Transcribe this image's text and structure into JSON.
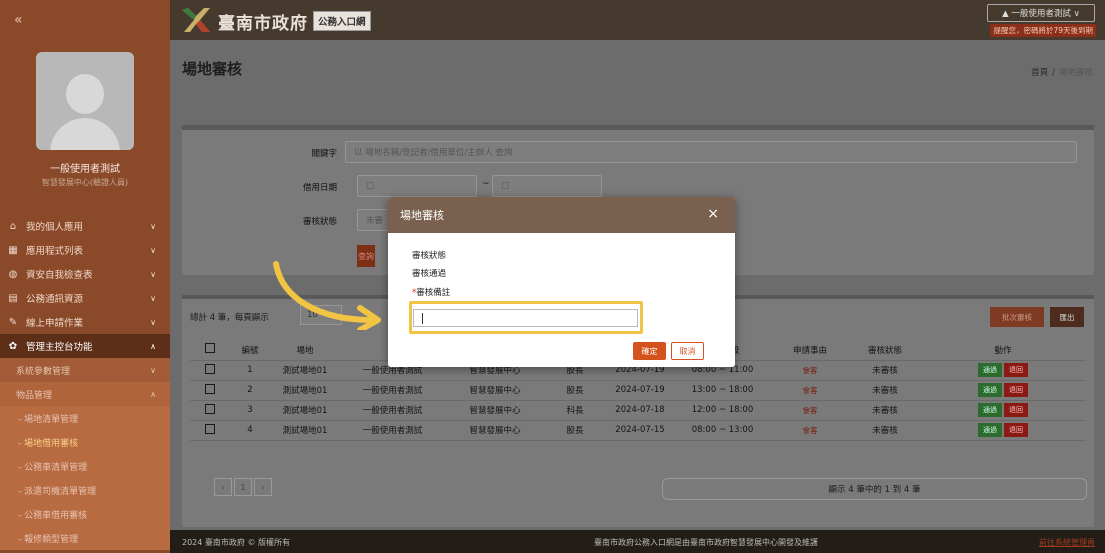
{
  "sidebar": {
    "collapse_label": "«",
    "user_name": "一般使用者測試",
    "user_dept": "智慧發展中心(驗證人員)",
    "menu": [
      {
        "icon": "home-icon",
        "glyph": "⌂",
        "label": "我的個人應用"
      },
      {
        "icon": "grid-icon",
        "glyph": "▦",
        "label": "應用程式列表"
      },
      {
        "icon": "shield-icon",
        "glyph": "◍",
        "label": "資安自我檢查表"
      },
      {
        "icon": "document-icon",
        "glyph": "▤",
        "label": "公務通訊資源"
      },
      {
        "icon": "pen-icon",
        "glyph": "✎",
        "label": "線上申請作業"
      },
      {
        "icon": "gear-icon",
        "glyph": "✿",
        "label": "管理主控台功能"
      }
    ],
    "submenu": [
      {
        "label": "系統參數管理"
      },
      {
        "label": "物品管理"
      }
    ],
    "sub2": [
      {
        "label": "- 場地清單管理"
      },
      {
        "label": "- 場地借用審核"
      },
      {
        "label": "- 公務車清單管理"
      },
      {
        "label": "- 派遣司機清單管理"
      },
      {
        "label": "- 公務車借用審核"
      },
      {
        "label": "- 報修類型管理"
      }
    ]
  },
  "header": {
    "site_title": "臺南市政府",
    "portal_badge": "公務入口網",
    "user_button": "▲ 一般使用者測試 ∨",
    "user_note": "提醒您，密碼將於79天後到期"
  },
  "page": {
    "title": "場地審核",
    "breadcrumb_home": "首頁",
    "breadcrumb_sep": "/",
    "breadcrumb_current": "場地審核"
  },
  "search": {
    "keyword_label": "關鍵字",
    "keyword_placeholder": "以 場地名稱/登記者/借用單位/主辦人 查詢",
    "date_label": "借用日期",
    "date_start_icon": "□",
    "date_to": "~",
    "date_end_icon": "□",
    "status_label": "審核狀態",
    "status_value": "未審",
    "query_button": "查詢"
  },
  "table": {
    "summary": "總計 4 筆，每頁顯示",
    "page_size": "10",
    "batch_button": "批次審核",
    "export_button": "匯出",
    "headers": [
      "",
      "編號",
      "場地",
      "",
      "",
      "",
      "登記時段",
      "申請事由",
      "審核狀態",
      "動作"
    ],
    "headers_visible": {
      "no": "編號",
      "venue": "場地",
      "slot": "登記時段",
      "reason": "申請事由",
      "status": "審核狀態",
      "action": "動作"
    },
    "rows": [
      {
        "no": "1",
        "venue": "測試場地01",
        "applicant": "一般使用者測試",
        "unit": "智慧發展中心",
        "title": "股長",
        "date": "2024-07-19",
        "slot": "08:00 ~ 11:00",
        "reason": "會客",
        "status": "未審核",
        "ok": "通過",
        "no_btn": "退回"
      },
      {
        "no": "2",
        "venue": "測試場地01",
        "applicant": "一般使用者測試",
        "unit": "智慧發展中心",
        "title": "股長",
        "date": "2024-07-19",
        "slot": "13:00 ~ 18:00",
        "reason": "會客",
        "status": "未審核",
        "ok": "通過",
        "no_btn": "退回"
      },
      {
        "no": "3",
        "venue": "測試場地01",
        "applicant": "一般使用者測試",
        "unit": "智慧發展中心",
        "title": "科長",
        "date": "2024-07-18",
        "slot": "12:00 ~ 18:00",
        "reason": "會客",
        "status": "未審核",
        "ok": "通過",
        "no_btn": "退回"
      },
      {
        "no": "4",
        "venue": "測試場地01",
        "applicant": "一般使用者測試",
        "unit": "智慧發展中心",
        "title": "股長",
        "date": "2024-07-15",
        "slot": "08:00 ~ 13:00",
        "reason": "會客",
        "status": "未審核",
        "ok": "通過",
        "no_btn": "退回"
      }
    ],
    "pager": [
      "‹",
      "1",
      "›"
    ],
    "showing": "顯示 4 筆中的 1 到 4 筆"
  },
  "modal": {
    "title": "場地審核",
    "close": "×",
    "status_label": "審核狀態",
    "status_value": "審核通過",
    "note_required_mark": "*",
    "note_label": "審核備註",
    "note_value": "",
    "ok_button": "確定",
    "cancel_button": "取消"
  },
  "footer": {
    "copyright": "2024 臺南市政府 © 版權所有",
    "center": "臺南市政府公務入口網是由臺南市政府智慧發展中心開發及維護",
    "link": "前往系統管理頁"
  },
  "colors": {
    "accent": "#d4531d",
    "highlight": "#f2c443",
    "sidebar": "#8a4a2a",
    "modal_header": "#7a614f"
  }
}
